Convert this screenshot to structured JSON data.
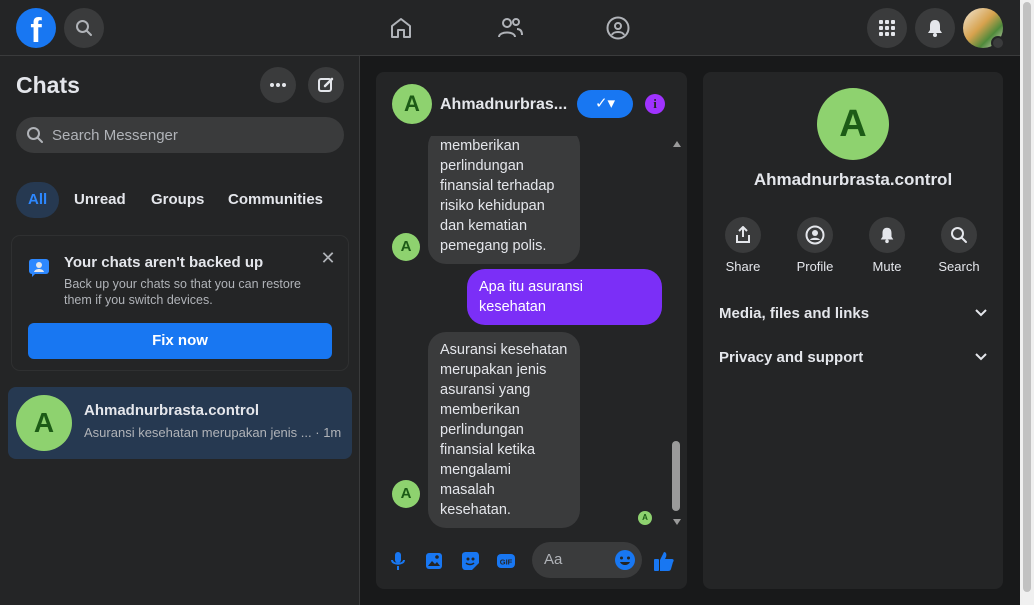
{
  "topbar": {
    "logo": "f",
    "icons": [
      "search-icon",
      "home-icon",
      "friends-icon",
      "groups-icon",
      "menu-grid-icon",
      "bell-icon"
    ]
  },
  "sidebar": {
    "title": "Chats",
    "search_placeholder": "Search Messenger",
    "filters": [
      "All",
      "Unread",
      "Groups",
      "Communities"
    ],
    "backup_notice": {
      "title": "Your chats aren't backed up",
      "description": "Back up your chats so that you can restore them if you switch devices.",
      "button": "Fix now"
    },
    "conversations": [
      {
        "avatar_letter": "A",
        "name": "Ahmadnurbrasta.control",
        "preview": "Asuransi kesehatan merupakan jenis ...",
        "time": "1m"
      }
    ]
  },
  "conversation": {
    "avatar_letter": "A",
    "name": "Ahmadnurbras...",
    "messages": [
      {
        "from": "them",
        "text": "memberikan perlindungan finansial terhadap risiko kehidupan dan kematian pemegang polis."
      },
      {
        "from": "me",
        "text": "Apa itu asuransi kesehatan"
      },
      {
        "from": "them",
        "text": "Asuransi kesehatan merupakan jenis asuransi yang memberikan perlindungan finansial ketika mengalami masalah kesehatan."
      }
    ],
    "composer_placeholder": "Aa"
  },
  "details": {
    "avatar_letter": "A",
    "name": "Ahmadnurbrasta.control",
    "actions": [
      "Share",
      "Profile",
      "Mute",
      "Search"
    ],
    "sections": [
      "Media, files and links",
      "Privacy and support"
    ]
  },
  "colors": {
    "accent": "#1877f2",
    "my_bubble": "#7b2ff7",
    "avatar": "#8ed26f",
    "info": "#a033ff"
  }
}
